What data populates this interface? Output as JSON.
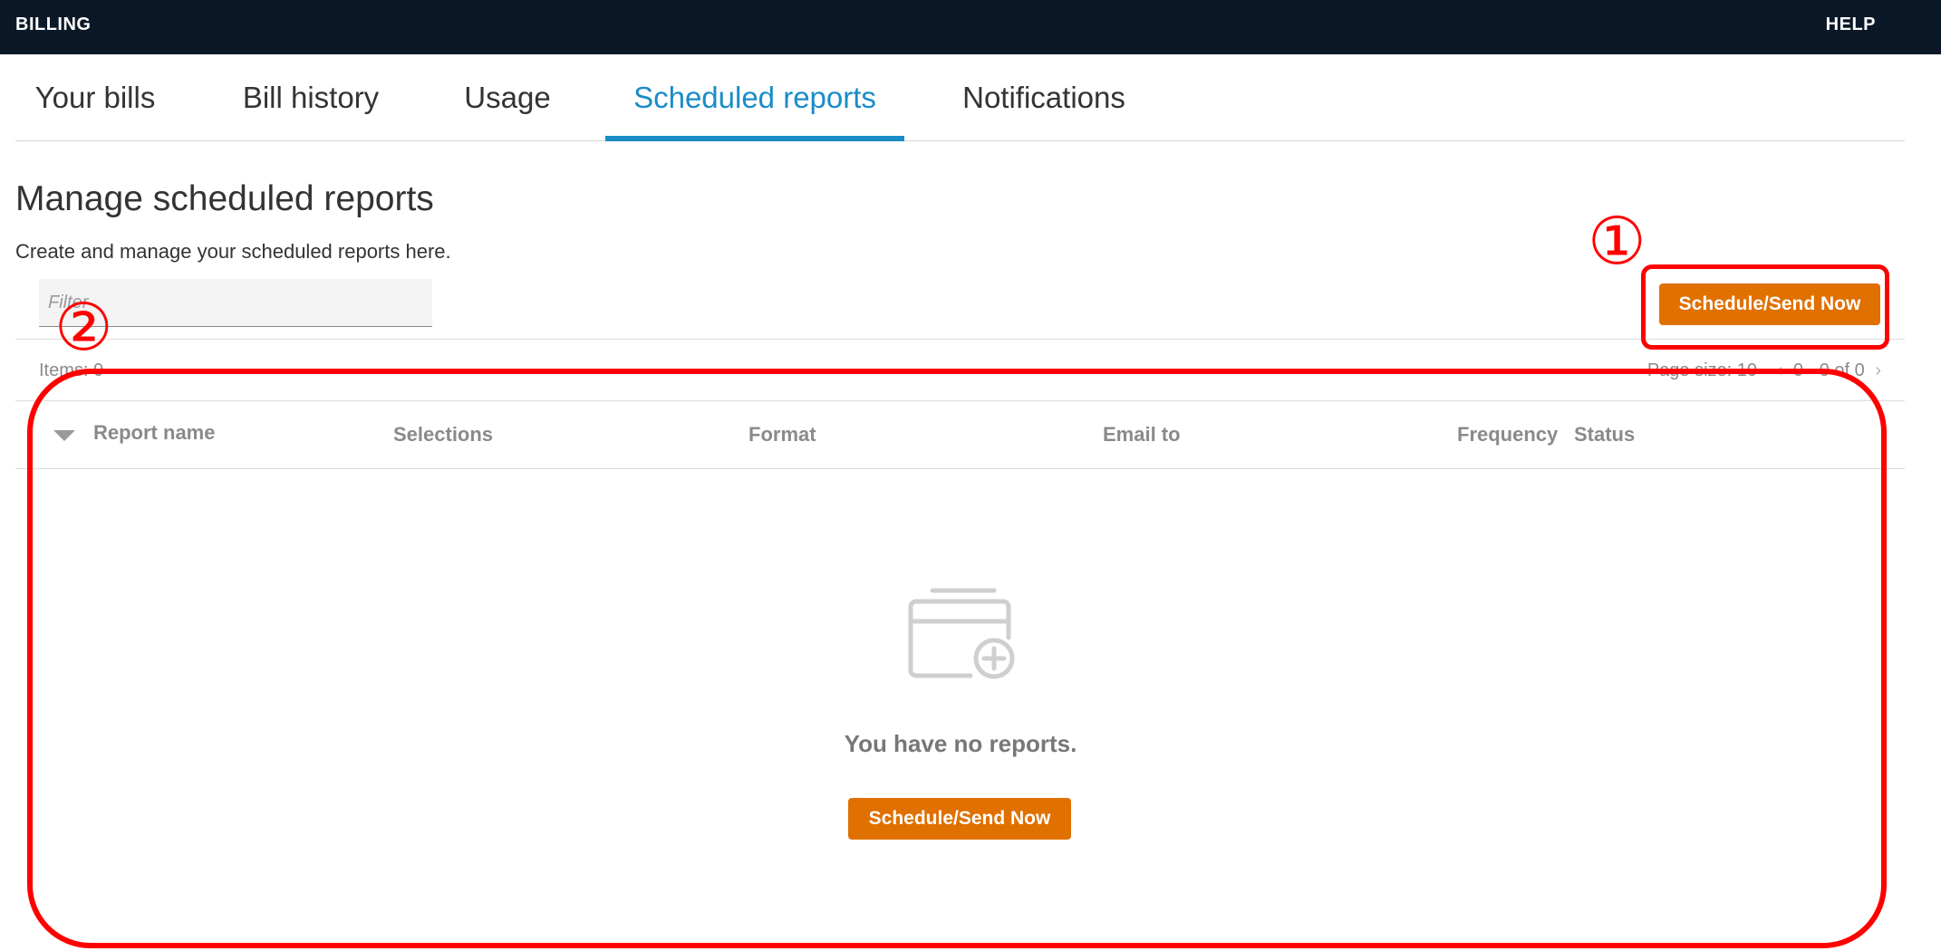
{
  "topbar": {
    "title": "BILLING",
    "help": "HELP"
  },
  "tabs": [
    {
      "label": "Your bills",
      "active": false
    },
    {
      "label": "Bill history",
      "active": false
    },
    {
      "label": "Usage",
      "active": false
    },
    {
      "label": "Scheduled reports",
      "active": true
    },
    {
      "label": "Notifications",
      "active": false
    }
  ],
  "page": {
    "title": "Manage scheduled reports",
    "subtitle": "Create and manage your scheduled reports here."
  },
  "filter": {
    "placeholder": "Filter",
    "value": ""
  },
  "actions": {
    "schedule_label": "Schedule/Send Now"
  },
  "pager": {
    "items": "Items: 0",
    "page_size": "Page size: 10",
    "range": "0 - 0 of 0"
  },
  "table": {
    "columns": [
      "Report name",
      "Selections",
      "Format",
      "Email to",
      "Frequency",
      "Status"
    ],
    "rows": []
  },
  "empty_state": {
    "icon": "report-add-icon",
    "message": "You have no reports.",
    "button_label": "Schedule/Send Now"
  },
  "annotations": {
    "marker_1": "①",
    "marker_2": "②"
  },
  "colors": {
    "topbar_bg": "#0b1827",
    "active_tab": "#1a8cc7",
    "button": "#e07000",
    "annotation": "#ff0000"
  }
}
